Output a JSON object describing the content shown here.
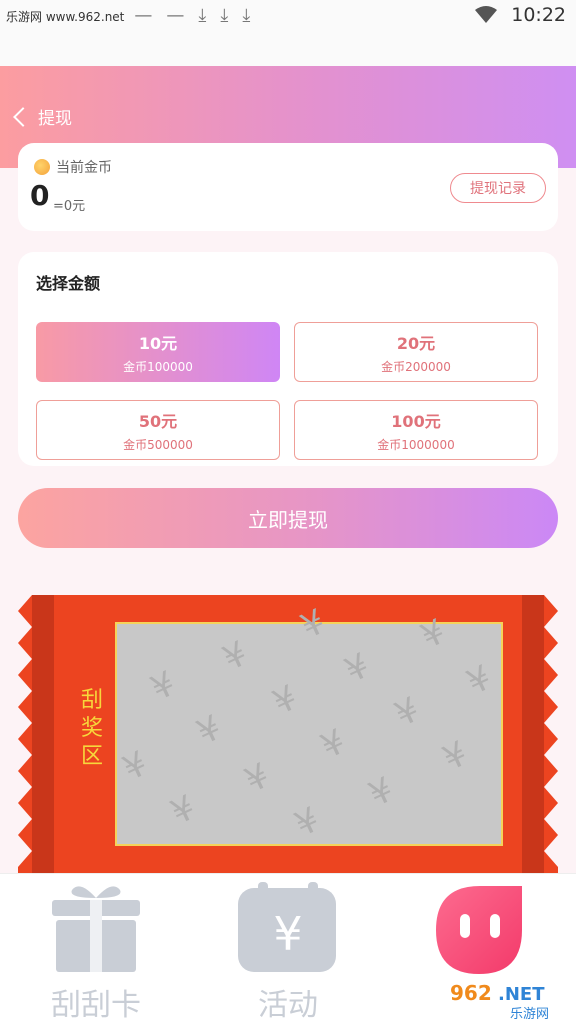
{
  "status_bar": {
    "watermark": "乐游网 www.962.net",
    "time": "10:22"
  },
  "header": {
    "title": "提现"
  },
  "coin_card": {
    "label": "当前金币",
    "value": "0",
    "equivalent": "=0元",
    "record_button": "提现记录"
  },
  "amount_card": {
    "title": "选择金额",
    "options": [
      {
        "amount": "10元",
        "coins": "金币100000",
        "selected": true
      },
      {
        "amount": "20元",
        "coins": "金币200000",
        "selected": false
      },
      {
        "amount": "50元",
        "coins": "金币500000",
        "selected": false
      },
      {
        "amount": "100元",
        "coins": "金币1000000",
        "selected": false
      }
    ]
  },
  "withdraw_button": "立即提现",
  "scratch_area": {
    "label": "刮奖区"
  },
  "tabbar": {
    "tabs": [
      {
        "label": "刮刮卡",
        "icon": "gift-icon"
      },
      {
        "label": "活动",
        "icon": "yuan-calendar-icon"
      },
      {
        "label": "",
        "icon": "mascot-icon"
      }
    ]
  },
  "colors": {
    "accent_pink": "#fc9da0",
    "accent_purple": "#cf8ff2",
    "scratch_red": "#ec4420"
  }
}
